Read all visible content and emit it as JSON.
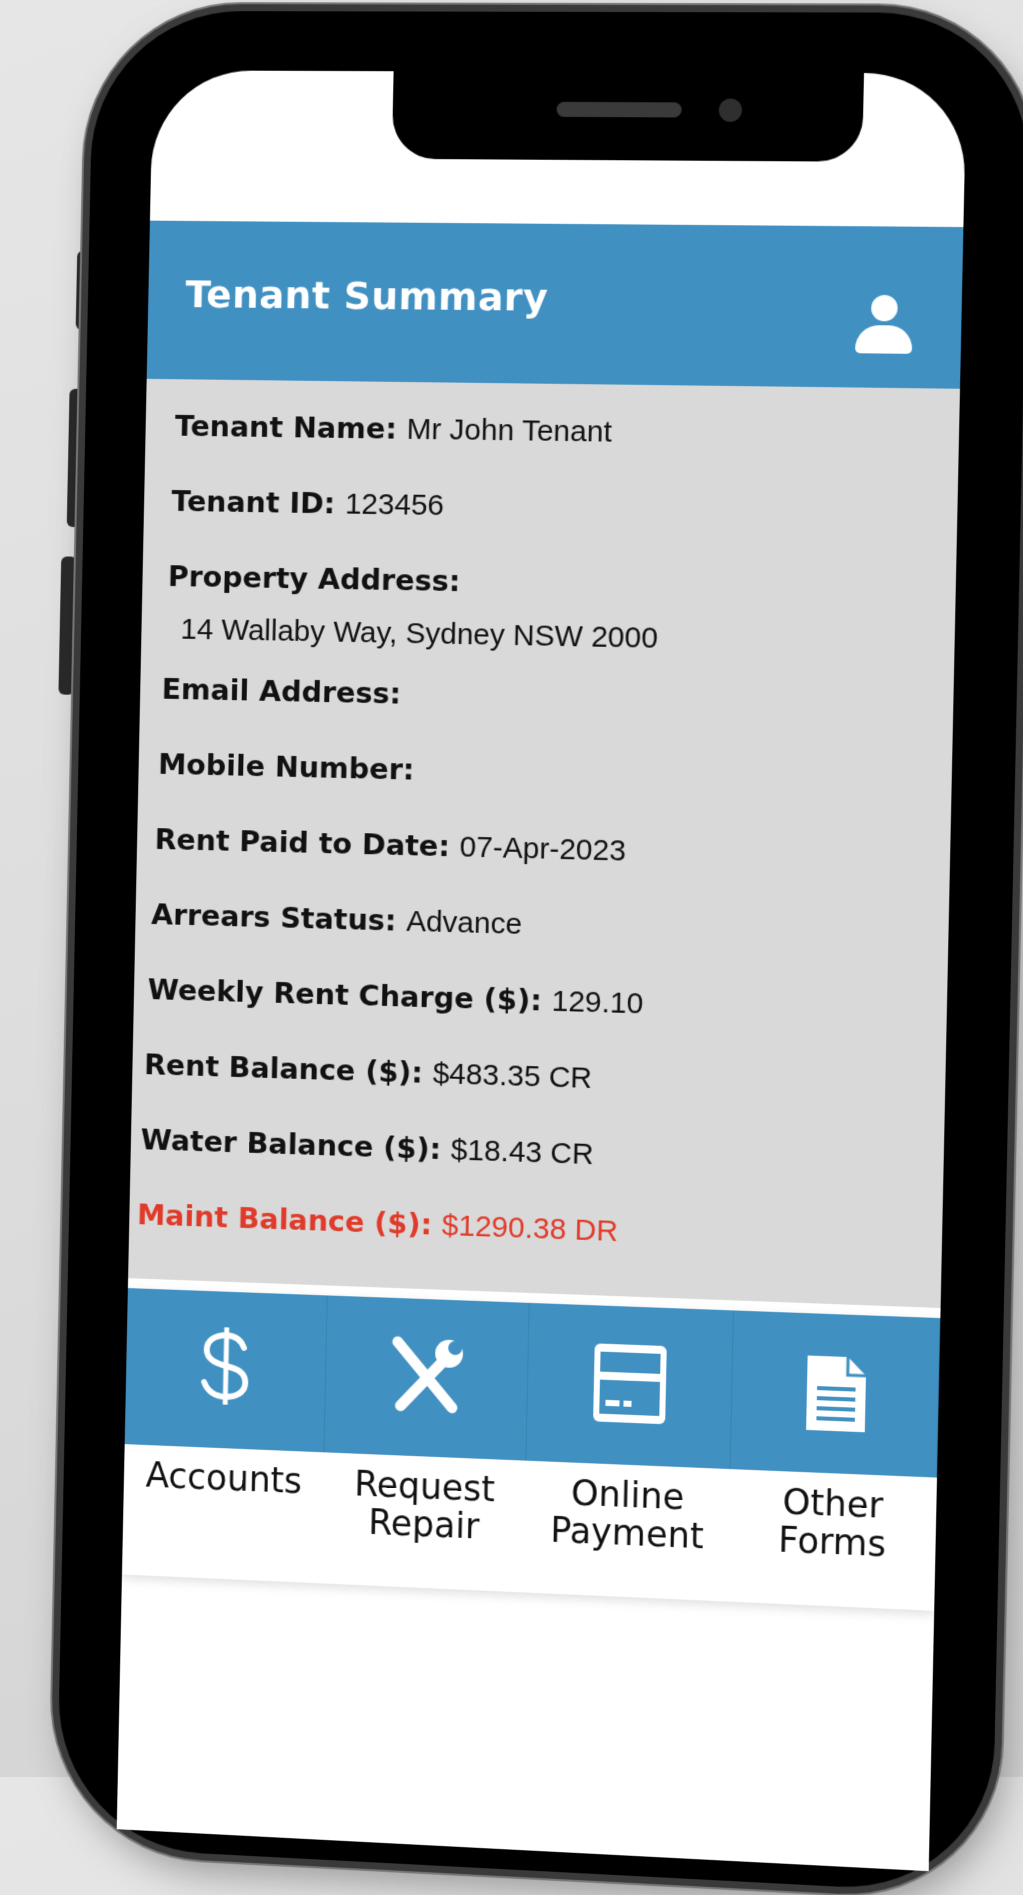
{
  "header": {
    "title": "Tenant Summary",
    "profile_icon": "user-icon"
  },
  "summary": {
    "tenant_name": {
      "label": "Tenant Name:",
      "value": "Mr John Tenant"
    },
    "tenant_id": {
      "label": "Tenant ID:",
      "value": "123456"
    },
    "property_address": {
      "label": "Property Address:",
      "value": "14 Wallaby Way, Sydney NSW 2000"
    },
    "email_address": {
      "label": "Email Address:",
      "value": ""
    },
    "mobile_number": {
      "label": "Mobile Number:",
      "value": ""
    },
    "rent_paid_to_date": {
      "label": "Rent Paid to Date:",
      "value": "07-Apr-2023"
    },
    "arrears_status": {
      "label": "Arrears Status:",
      "value": "Advance"
    },
    "weekly_rent_charge": {
      "label": "Weekly Rent Charge ($):",
      "value": "129.10"
    },
    "rent_balance": {
      "label": "Rent Balance ($):",
      "value": "$483.35 CR"
    },
    "water_balance": {
      "label": "Water Balance ($):",
      "value": "$18.43 CR"
    },
    "maint_balance": {
      "label": "Maint Balance ($):",
      "value": "$1290.38 DR"
    }
  },
  "nav": {
    "items": [
      {
        "label": "Accounts",
        "icon": "dollar-icon"
      },
      {
        "label": "Request\nRepair",
        "icon": "tools-icon"
      },
      {
        "label": "Online\nPayment",
        "icon": "credit-card-icon"
      },
      {
        "label": "Other\nForms",
        "icon": "document-icon"
      }
    ]
  },
  "colors": {
    "header_blue": "#4190c2",
    "summary_bg": "#d9d9d9",
    "alert_red": "#e03b2a"
  }
}
